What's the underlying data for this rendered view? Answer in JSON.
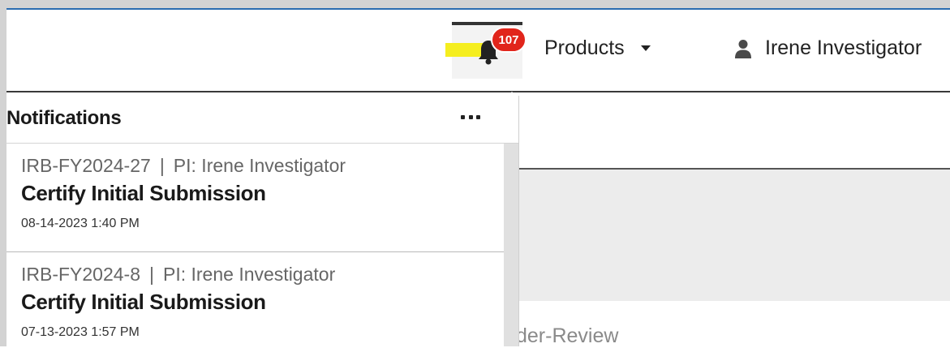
{
  "header": {
    "notification_count": "107",
    "products_label": "Products",
    "user_name": "Irene Investigator"
  },
  "notifications": {
    "title": "Notifications",
    "items": [
      {
        "ref": "IRB-FY2024-27",
        "pi": "PI: Irene Investigator",
        "title": "Certify Initial Submission",
        "time": "08-14-2023 1:40 PM"
      },
      {
        "ref": "IRB-FY2024-8",
        "pi": "PI: Irene Investigator",
        "title": "Certify Initial Submission",
        "time": "07-13-2023 1:57 PM"
      }
    ]
  },
  "background": {
    "partial_status_text": "der-Review"
  },
  "colors": {
    "badge": "#e1251b",
    "highlight": "#f5ee1f",
    "frame_accent": "#2b6cb0"
  }
}
